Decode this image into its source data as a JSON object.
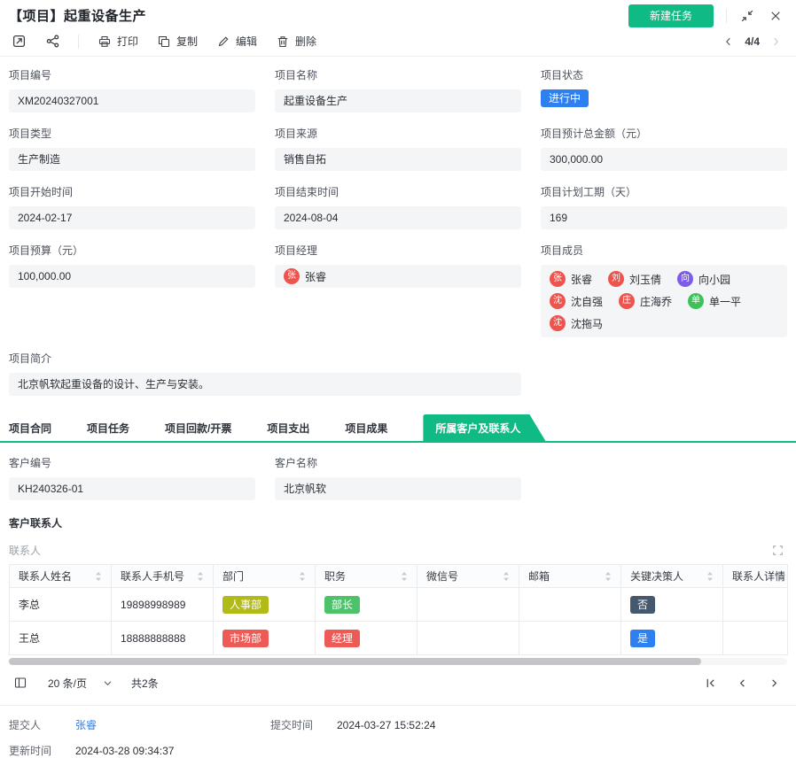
{
  "colors": {
    "brand": "#10ba84",
    "blue": "#2e7ff0"
  },
  "header": {
    "title": "【项目】起重设备生产",
    "new_task": "新建任务"
  },
  "toolbar": {
    "print": "打印",
    "copy": "复制",
    "edit": "编辑",
    "del": "删除",
    "pager": "4/4"
  },
  "fields": {
    "code": {
      "label": "项目编号",
      "value": "XM20240327001"
    },
    "name": {
      "label": "项目名称",
      "value": "起重设备生产"
    },
    "status": {
      "label": "项目状态",
      "value": "进行中",
      "color": "#2e7ff0"
    },
    "type": {
      "label": "项目类型",
      "value": "生产制造"
    },
    "source": {
      "label": "项目来源",
      "value": "销售自拓"
    },
    "est": {
      "label": "项目预计总金额（元）",
      "value": "300,000.00"
    },
    "start": {
      "label": "项目开始时间",
      "value": "2024-02-17"
    },
    "end": {
      "label": "项目结束时间",
      "value": "2024-08-04"
    },
    "days": {
      "label": "项目计划工期（天）",
      "value": "169"
    },
    "budget": {
      "label": "项目预算（元）",
      "value": "100,000.00"
    },
    "manager": {
      "label": "项目经理",
      "name": "张睿",
      "avatar": "张",
      "color": "#ee544d"
    },
    "members": {
      "label": "项目成员",
      "list": [
        {
          "name": "张睿",
          "avatar": "张",
          "color": "#ee544d"
        },
        {
          "name": "刘玉倩",
          "avatar": "刘",
          "color": "#ee544d"
        },
        {
          "name": "向小园",
          "avatar": "向",
          "color": "#7c5ce8"
        },
        {
          "name": "沈自强",
          "avatar": "沈",
          "color": "#ee544d"
        },
        {
          "name": "庄海乔",
          "avatar": "庄",
          "color": "#ee544d"
        },
        {
          "name": "单一平",
          "avatar": "单",
          "color": "#3cc258"
        },
        {
          "name": "沈拖马",
          "avatar": "沈",
          "color": "#ee544d"
        }
      ]
    },
    "intro": {
      "label": "项目简介",
      "value": "北京帆软起重设备的设计、生产与安装。"
    }
  },
  "tabs": [
    {
      "label": "项目合同"
    },
    {
      "label": "项目任务"
    },
    {
      "label": "项目回款/开票"
    },
    {
      "label": "项目支出"
    },
    {
      "label": "项目成果"
    },
    {
      "label": "所属客户及联系人"
    }
  ],
  "customer": {
    "code_label": "客户编号",
    "code": "KH240326-01",
    "name_label": "客户名称",
    "name": "北京帆软",
    "section": "客户联系人",
    "subtable": "联系人"
  },
  "table": {
    "headers": [
      "联系人姓名",
      "联系人手机号",
      "部门",
      "职务",
      "微信号",
      "邮箱",
      "关键决策人",
      "联系人详情"
    ],
    "rows": [
      {
        "name": "李总",
        "phone": "19898998989",
        "dept": "人事部",
        "dept_color": "#b2ba17",
        "title": "部长",
        "title_color": "#4cc368",
        "wechat": "",
        "email": "",
        "key": "否",
        "key_color": "#45586d",
        "detail": ""
      },
      {
        "name": "王总",
        "phone": "18888888888",
        "dept": "市场部",
        "dept_color": "#ee5b56",
        "title": "经理",
        "title_color": "#ee5b56",
        "wechat": "",
        "email": "",
        "key": "是",
        "key_color": "#2e7ff0",
        "detail": ""
      }
    ]
  },
  "pagination": {
    "page_size": "20 条/页",
    "total": "共2条"
  },
  "footer": {
    "submitter_label": "提交人",
    "submitter": "张睿",
    "submit_time_label": "提交时间",
    "submit_time": "2024-03-27 15:52:24",
    "update_label": "更新时间",
    "update_time": "2024-03-28 09:34:37"
  }
}
